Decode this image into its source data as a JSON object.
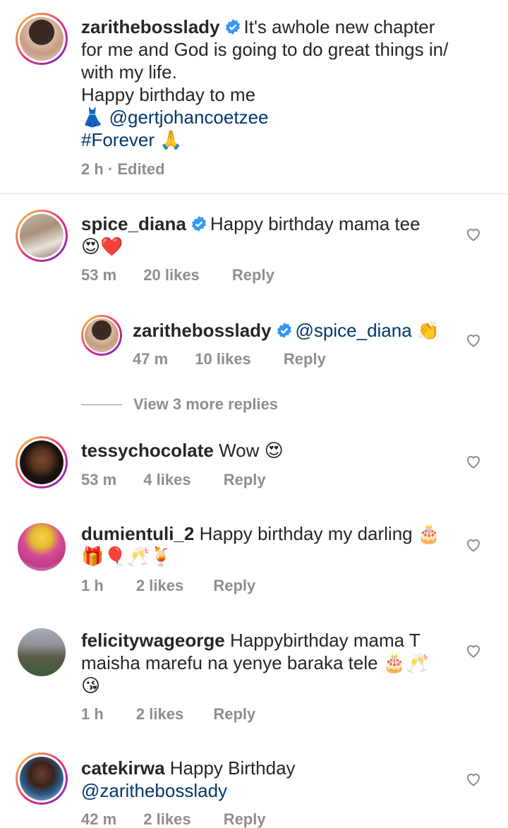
{
  "post": {
    "username": "zarithebosslady",
    "caption_line1": "It's awhole new chapter",
    "caption_line2": "for me and God is going to do great things in/",
    "caption_line3": "with my life.",
    "caption_line4": "Happy birthday to me",
    "dress_emoji": "👗",
    "mention": "@gertjohancoetzee",
    "hashtag": "#Forever",
    "pray_emoji": "🙏",
    "meta": "2 h · Edited"
  },
  "comments": [
    {
      "username": "spice_diana",
      "text": "Happy birthday mama tee",
      "emoji_line": "😍❤️",
      "time": "53 m",
      "likes": "20 likes",
      "reply": "Reply"
    },
    {
      "username": "zarithebosslady",
      "mention": "@spice_diana",
      "emoji": "👏",
      "time": "47 m",
      "likes": "10 likes",
      "reply": "Reply"
    },
    {
      "username": "tessychocolate",
      "text": "Wow",
      "emoji": "😍",
      "time": "53 m",
      "likes": "4 likes",
      "reply": "Reply"
    },
    {
      "username": "dumientuli_2",
      "text": "Happy birthday my darling",
      "emoji": "🎂",
      "emoji_line": "🎁🎈🥂🍹",
      "time": "1 h",
      "likes": "2 likes",
      "reply": "Reply"
    },
    {
      "username": "felicitywageorge",
      "text_line1": "Happybirthday mama T",
      "text_line2": "maisha marefu na yenye baraka tele",
      "emoji_inline": "🎂🥂",
      "emoji_line": "😘",
      "time": "1 h",
      "likes": "2 likes",
      "reply": "Reply"
    },
    {
      "username": "catekirwa",
      "text": "Happy Birthday",
      "mention": "@zarithebosslady",
      "time": "42 m",
      "likes": "2 likes",
      "reply": "Reply"
    }
  ],
  "view_replies": "View 3 more replies",
  "colors": {
    "text": "#262626",
    "secondary": "#8e8e8e",
    "link": "#00376b",
    "verified": "#3897f0"
  }
}
